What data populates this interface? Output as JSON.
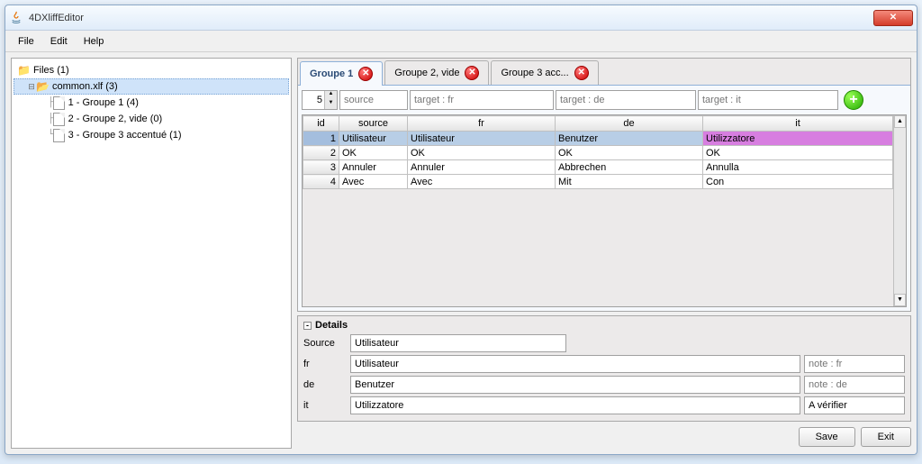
{
  "title": "4DXliffEditor",
  "menus": {
    "file": "File",
    "edit": "Edit",
    "help": "Help"
  },
  "tree": {
    "root": "Files (1)",
    "file": "common.xlf (3)",
    "g1": "1 - Groupe 1 (4)",
    "g2": "2 - Groupe 2, vide (0)",
    "g3": "3 - Groupe 3 accentué (1)"
  },
  "tabs": {
    "t1": "Groupe 1",
    "t2": "Groupe 2, vide",
    "t3": "Groupe 3 acc..."
  },
  "filter": {
    "spin": "5",
    "source_ph": "source",
    "fr_ph": "target : fr",
    "de_ph": "target : de",
    "it_ph": "target : it"
  },
  "headers": {
    "id": "id",
    "source": "source",
    "fr": "fr",
    "de": "de",
    "it": "it"
  },
  "rows": [
    {
      "id": "1",
      "source": "Utilisateur",
      "fr": "Utilisateur",
      "de": "Benutzer",
      "it": "Utilizzatore"
    },
    {
      "id": "2",
      "source": "OK",
      "fr": "OK",
      "de": "OK",
      "it": "OK"
    },
    {
      "id": "3",
      "source": "Annuler",
      "fr": "Annuler",
      "de": "Abbrechen",
      "it": "Annulla"
    },
    {
      "id": "4",
      "source": "Avec",
      "fr": "Avec",
      "de": "Mit",
      "it": "Con"
    }
  ],
  "details": {
    "title": "Details",
    "source_label": "Source",
    "source_val": "Utilisateur",
    "fr_label": "fr",
    "fr_val": "Utilisateur",
    "fr_note_ph": "note : fr",
    "de_label": "de",
    "de_val": "Benutzer",
    "de_note_ph": "note : de",
    "it_label": "it",
    "it_val": "Utilizzatore",
    "it_note": "A vérifier"
  },
  "buttons": {
    "save": "Save",
    "exit": "Exit"
  }
}
